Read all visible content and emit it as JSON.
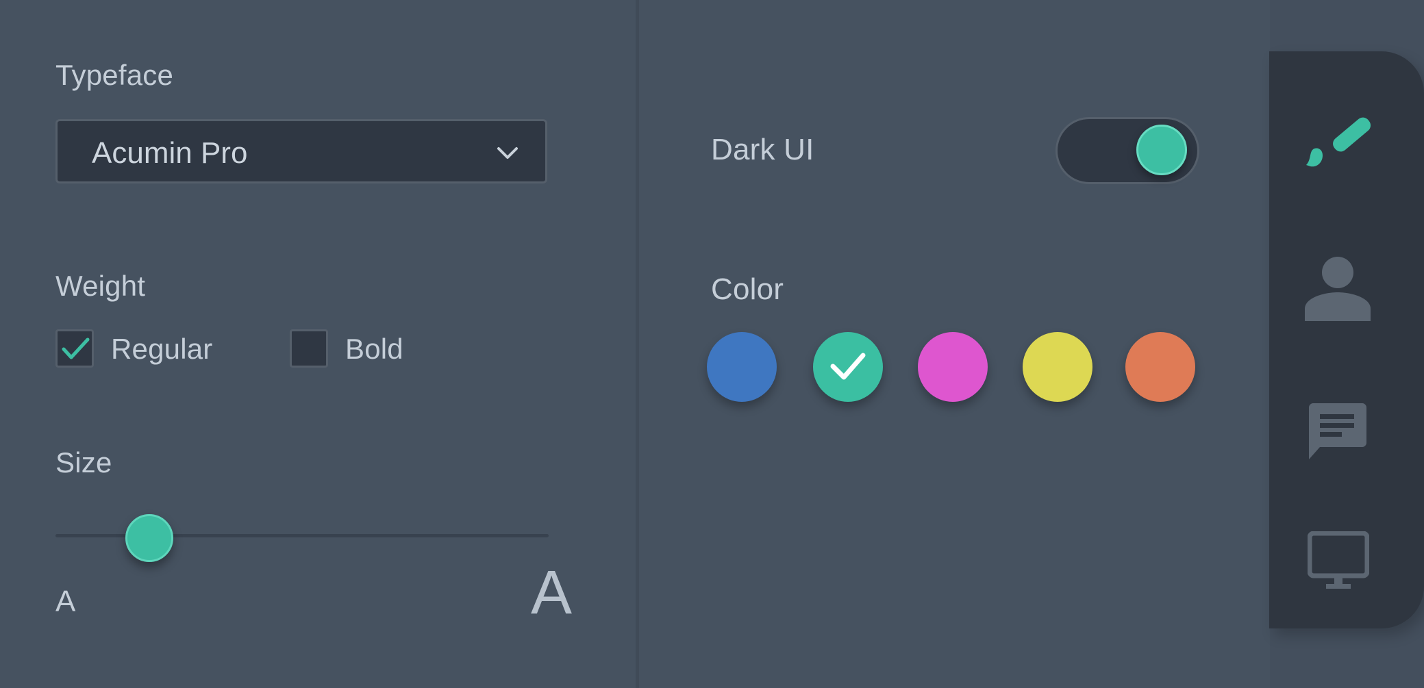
{
  "typeface": {
    "label": "Typeface",
    "selected": "Acumin Pro"
  },
  "weight": {
    "label": "Weight",
    "options": [
      {
        "label": "Regular",
        "checked": true
      },
      {
        "label": "Bold",
        "checked": false
      }
    ]
  },
  "size": {
    "label": "Size",
    "min_label": "A",
    "max_label": "A",
    "value_fraction": 0.19
  },
  "dark_ui": {
    "label": "Dark UI",
    "on": true
  },
  "color": {
    "label": "Color",
    "swatches": [
      "#3f77c1",
      "#3bbfa2",
      "#de56cf",
      "#ddd853",
      "#df7b56"
    ],
    "selected_index": 1
  },
  "sidebar": {
    "items": [
      {
        "icon": "paintbrush-icon",
        "active": true
      },
      {
        "icon": "user-icon",
        "active": false
      },
      {
        "icon": "chat-icon",
        "active": false
      },
      {
        "icon": "monitor-icon",
        "active": false
      }
    ]
  },
  "colors": {
    "accent": "#3dbfa3",
    "panel": "#465260",
    "control_bg": "#2f3743",
    "sidebar_bg": "#2f3640",
    "inactive_icon": "#5c6672"
  }
}
